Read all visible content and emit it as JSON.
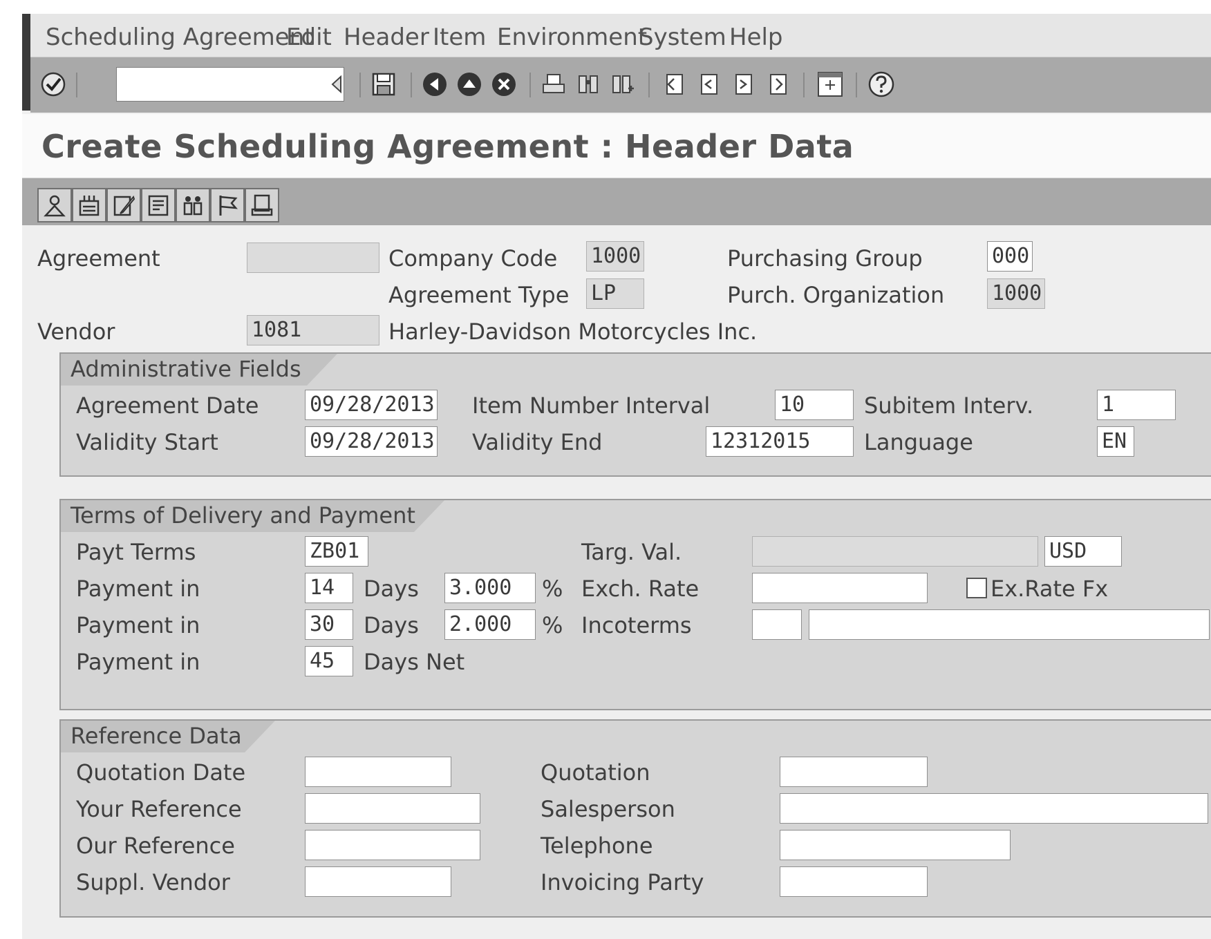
{
  "menu": [
    "Scheduling Agreement",
    "Edit",
    "Header",
    "Item",
    "Environment",
    "System",
    "Help"
  ],
  "command_field": {
    "value": ""
  },
  "toolbar_icons": [
    "enter-icon",
    "back-arrow-icon",
    "save-icon",
    "back-icon",
    "exit-icon",
    "cancel-icon",
    "print-icon",
    "find-icon",
    "find-next-icon",
    "first-page-icon",
    "previous-page-icon",
    "next-page-icon",
    "last-page-icon",
    "layout-icon",
    "help-icon"
  ],
  "title": "Create Scheduling Agreement : Header Data",
  "app_toolbar_icons": [
    "partners-icon",
    "conditions-icon",
    "texts-icon",
    "document-overview-icon",
    "messages-icon",
    "flag-icon",
    "print-preview-icon"
  ],
  "header": {
    "agreement": {
      "label": "Agreement",
      "value": ""
    },
    "company_code": {
      "label": "Company Code",
      "value": "1000"
    },
    "purchasing_group": {
      "label": "Purchasing Group",
      "value": "000"
    },
    "agreement_type": {
      "label": "Agreement Type",
      "value": "LP"
    },
    "purch_org": {
      "label": "Purch. Organization",
      "value": "1000"
    },
    "vendor": {
      "label": "Vendor",
      "value": "1081",
      "name": "Harley-Davidson Motorcycles Inc."
    }
  },
  "admin": {
    "title": "Administrative Fields",
    "agreement_date": {
      "label": "Agreement Date",
      "value": "09/28/2013"
    },
    "item_interval": {
      "label": "Item Number Interval",
      "value": "10"
    },
    "subitem_interval": {
      "label": "Subitem Interv.",
      "value": "1"
    },
    "validity_start": {
      "label": "Validity Start",
      "value": "09/28/2013"
    },
    "validity_end": {
      "label": "Validity End",
      "value": "12312015"
    },
    "language": {
      "label": "Language",
      "value": "EN"
    }
  },
  "terms": {
    "title": "Terms of Delivery and Payment",
    "payt_terms": {
      "label": "Payt Terms",
      "value": "ZB01"
    },
    "targ_val": {
      "label": "Targ. Val.",
      "value": "",
      "currency": "USD"
    },
    "payments": [
      {
        "label": "Payment in",
        "days": "14",
        "unit": "Days",
        "percent": "3.000",
        "pct_sign": "%"
      },
      {
        "label": "Payment in",
        "days": "30",
        "unit": "Days",
        "percent": "2.000",
        "pct_sign": "%"
      },
      {
        "label": "Payment in",
        "days": "45",
        "unit": "Days Net"
      }
    ],
    "exch_rate": {
      "label": "Exch. Rate",
      "value": ""
    },
    "exrate_fx": {
      "label": "Ex.Rate Fx",
      "checked": false
    },
    "incoterms": {
      "label": "Incoterms",
      "value1": "",
      "value2": ""
    }
  },
  "reference": {
    "title": "Reference Data",
    "quotation_date": {
      "label": "Quotation Date",
      "value": ""
    },
    "quotation": {
      "label": "Quotation",
      "value": ""
    },
    "your_reference": {
      "label": "Your Reference",
      "value": ""
    },
    "salesperson": {
      "label": "Salesperson",
      "value": ""
    },
    "our_reference": {
      "label": "Our Reference",
      "value": ""
    },
    "telephone": {
      "label": "Telephone",
      "value": ""
    },
    "suppl_vendor": {
      "label": "Suppl. Vendor",
      "value": ""
    },
    "invoicing_party": {
      "label": "Invoicing Party",
      "value": ""
    }
  }
}
